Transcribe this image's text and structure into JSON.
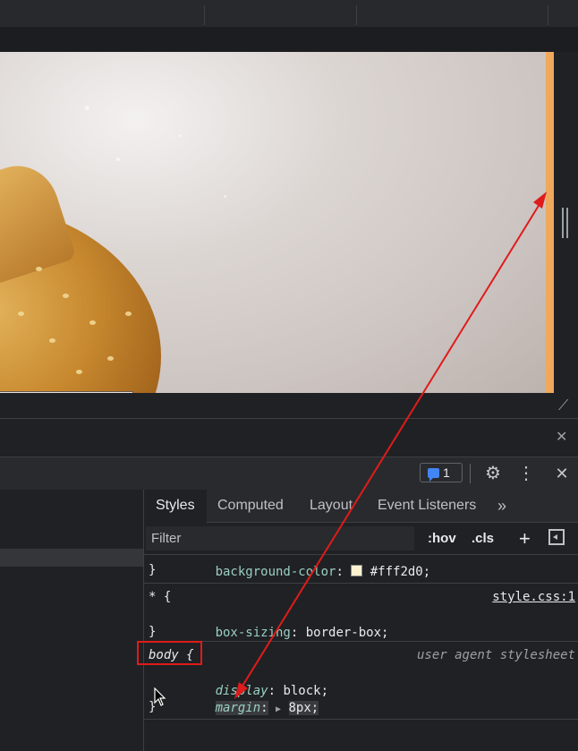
{
  "devtools_toolbar": {
    "issues_count": "1",
    "icons": [
      "issues-chat-icon",
      "gear-icon",
      "kebab-menu-icon",
      "close-icon"
    ]
  },
  "styles_panel": {
    "tabs": [
      "Styles",
      "Computed",
      "Layout",
      "Event Listeners",
      "»"
    ],
    "active_tab": "Styles",
    "filter_placeholder": "Filter",
    "hov_label": ":hov",
    "cls_label": ".cls",
    "add_rule_icon": "+",
    "toggle_sidebar_icon": "sidebar-toggle-icon",
    "rules": {
      "partial": {
        "prop": "background-color",
        "value": "#fff2d0",
        "swatch_color": "#fff2d0",
        "close": "}"
      },
      "universal": {
        "selector": "* {",
        "source": "style.css:1",
        "prop": "box-sizing",
        "value": "border-box;",
        "close": "}"
      },
      "body": {
        "selector": "body {",
        "source": "user agent stylesheet",
        "decl1_prop": "display",
        "decl1_value": "block;",
        "decl2_prop": "margin",
        "decl2_value": "8px;",
        "close": "}"
      }
    }
  },
  "annotation": {
    "highlight_color": "#e01b1b"
  },
  "viewport": {
    "edge_color": "#f0a85d"
  }
}
